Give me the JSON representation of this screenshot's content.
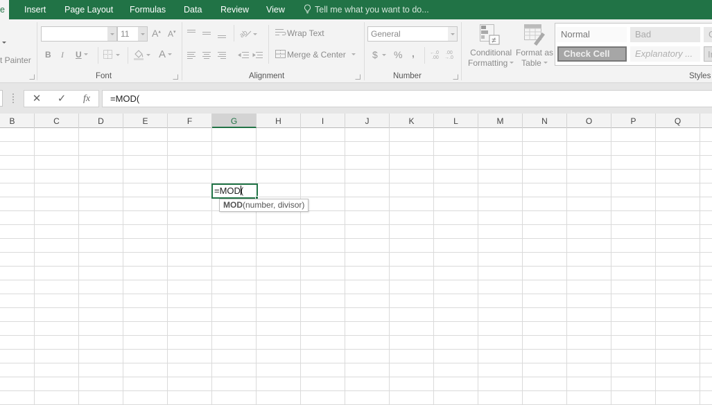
{
  "tabs": [
    {
      "label": "e",
      "active": true
    },
    {
      "label": "Insert"
    },
    {
      "label": "Page Layout"
    },
    {
      "label": "Formulas"
    },
    {
      "label": "Data"
    },
    {
      "label": "Review"
    },
    {
      "label": "View"
    }
  ],
  "tell_me": "Tell me what you want to do...",
  "ribbon": {
    "clipboard": {
      "format_painter": "t Painter"
    },
    "font": {
      "group_label": "Font",
      "font_name": "",
      "font_size": "11",
      "bold": "B",
      "italic": "I",
      "underline": "U",
      "grow": "A",
      "shrink": "A",
      "font_color": "A"
    },
    "alignment": {
      "group_label": "Alignment",
      "wrap_text": "Wrap Text",
      "merge_center": "Merge & Center"
    },
    "number": {
      "group_label": "Number",
      "format": "General",
      "currency": "$",
      "percent": "%",
      "comma": ",",
      "inc_decimal": "←.0 .00",
      "dec_decimal": ".00 →.0"
    },
    "styles": {
      "group_label": "Styles",
      "conditional_formatting": [
        "Conditional",
        "Formatting"
      ],
      "format_as_table": [
        "Format as",
        "Table"
      ],
      "gallery": [
        "Normal",
        "Bad",
        "G",
        "Check Cell",
        "Explanatory ...",
        "In"
      ]
    }
  },
  "formula_bar": {
    "cancel": "✕",
    "enter": "✓",
    "fx": "fx",
    "value": "=MOD("
  },
  "columns": [
    "B",
    "C",
    "D",
    "E",
    "F",
    "G",
    "H",
    "I",
    "J",
    "K",
    "L",
    "M",
    "N",
    "O",
    "P",
    "Q"
  ],
  "selected_column": "G",
  "active_cell": {
    "column": "G",
    "text": "=MOD("
  },
  "tooltip": {
    "func": "MOD",
    "args": "(number, divisor)"
  },
  "colors": {
    "accent": "#217346",
    "ribbon_bg": "#f3f3f3",
    "gridline": "#dadada"
  }
}
